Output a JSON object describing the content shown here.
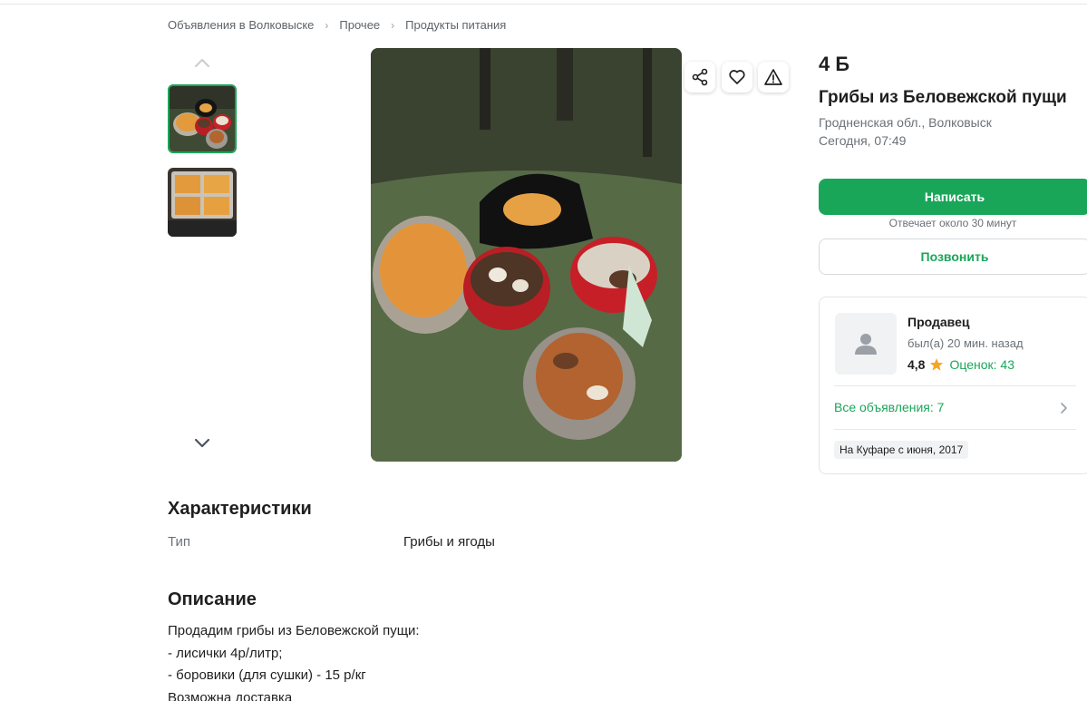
{
  "breadcrumb": [
    "Объявления в Волковыске",
    "Прочее",
    "Продукты питания"
  ],
  "gallery": {
    "thumbnails": [
      {
        "alt": "grib-baskets-thumbnail",
        "selected": true
      },
      {
        "alt": "chanterelle-trays-thumbnail",
        "selected": false
      }
    ]
  },
  "ad": {
    "price": "4 Ƃ",
    "title": "Грибы из Беловежской пущи",
    "location": "Гродненская обл., Волковыск",
    "date": "Сегодня, 07:49"
  },
  "actions": {
    "write_label": "Написать",
    "reply_note": "Отвечает около 30 минут",
    "call_label": "Позвонить"
  },
  "seller": {
    "label": "Продавец",
    "last_seen": "был(а) 20 мин. назад",
    "rating": "4,8",
    "reviews": "Оценок: 43",
    "all_ads": "Все объявления: 7",
    "since": "На Куфаре с июня, 2017"
  },
  "characteristics": {
    "heading": "Характеристики",
    "rows": [
      {
        "key": "Тип",
        "value": "Грибы и ягоды"
      }
    ]
  },
  "description": {
    "heading": "Описание",
    "lines": [
      "Продадим грибы из Беловежской пущи:",
      "- лисички 4р/литр;",
      "- боровики (для сушки) - 15 р/кг",
      "Возможна доставка"
    ]
  },
  "colors": {
    "accent": "#1aa659",
    "star": "#f5a623"
  }
}
